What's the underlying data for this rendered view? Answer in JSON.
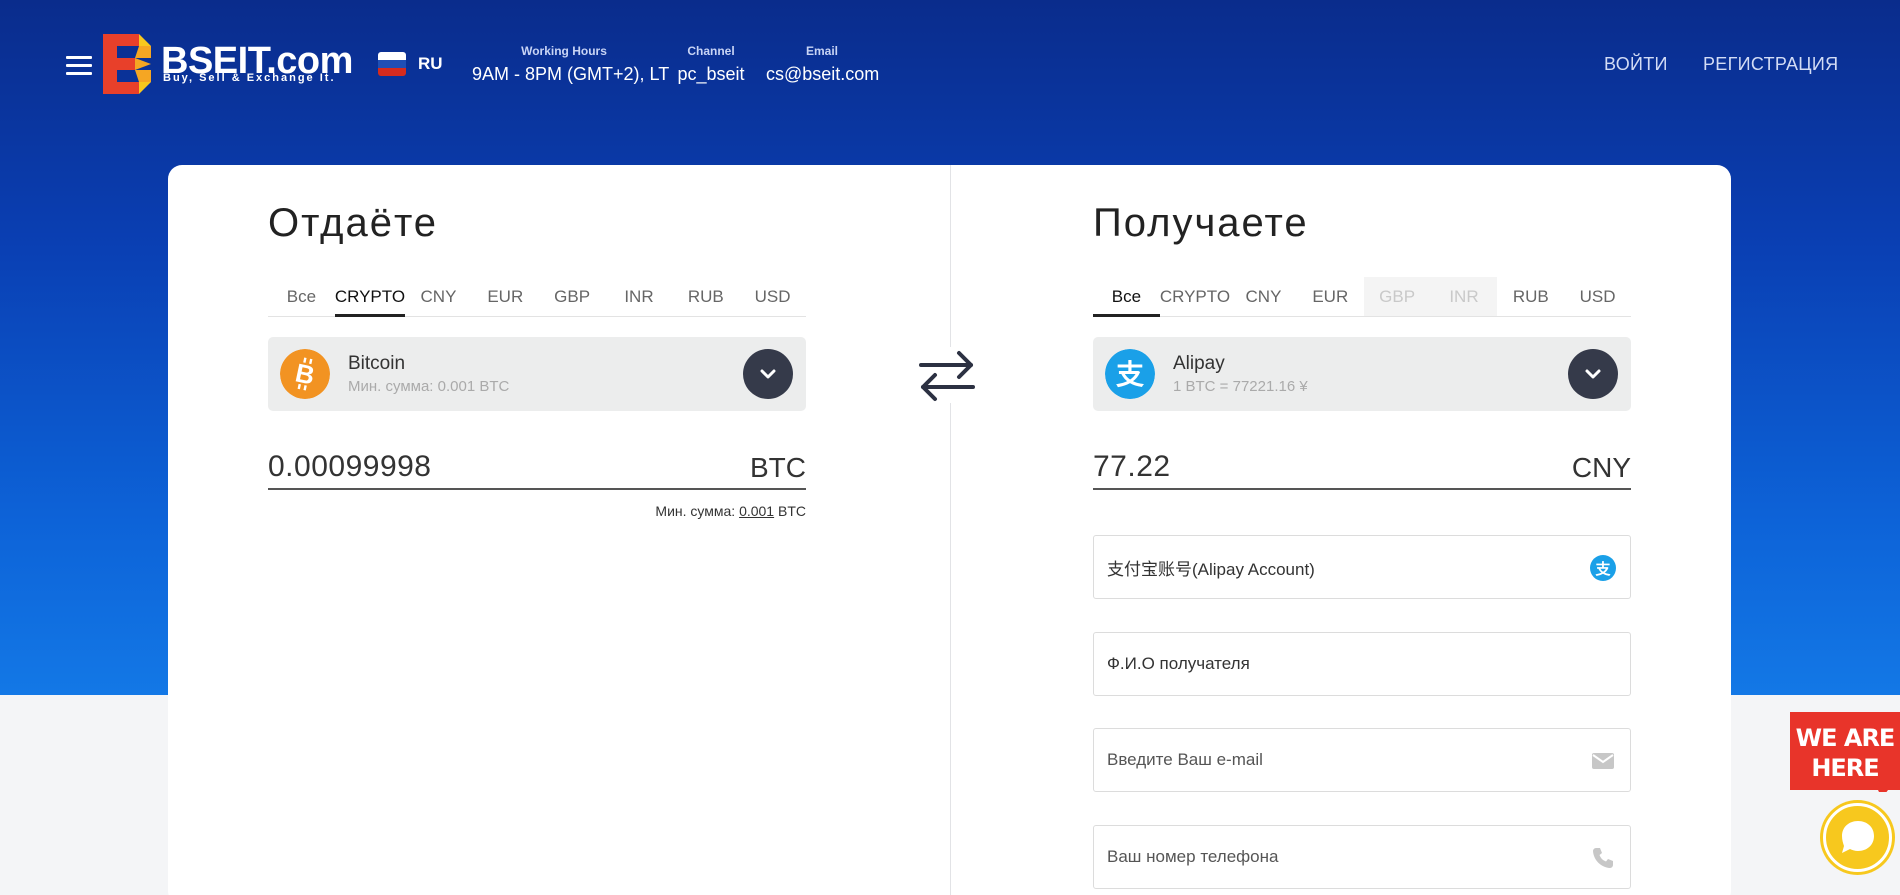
{
  "brand": {
    "name": "BSEIT.com",
    "tagline": "Buy, Sell & Exchange It.",
    "colors": {
      "orange": "#f5a623",
      "red": "#e8402a",
      "yellow": "#f7c81e",
      "hero_blue": "#0a3fb3"
    }
  },
  "header": {
    "menu_icon": "hamburger-icon",
    "language": {
      "code": "RU",
      "flag": "russia-flag-icon"
    },
    "info": [
      {
        "label": "Working Hours",
        "value": "9AM - 8PM (GMT+2), LT"
      },
      {
        "label": "Channel",
        "value": "pc_bseit"
      },
      {
        "label": "Email",
        "value": "cs@bseit.com"
      }
    ],
    "login": "ВОЙТИ",
    "register": "РЕГИСТРАЦИЯ"
  },
  "give": {
    "title": "Отдаёте",
    "tabs": [
      "Все",
      "CRYPTO",
      "CNY",
      "EUR",
      "GBP",
      "INR",
      "RUB",
      "USD"
    ],
    "active_tab": "CRYPTO",
    "currency": {
      "name": "Bitcoin",
      "sub": "Мин. сумма: 0.001 BTC",
      "icon": "bitcoin-icon"
    },
    "amount": "0.00099998",
    "amount_currency": "BTC",
    "min_note": {
      "prefix": "Мин. сумма:",
      "value": "0.001",
      "suffix": "BTC"
    }
  },
  "get": {
    "title": "Получаете",
    "tabs": [
      "Все",
      "CRYPTO",
      "CNY",
      "EUR",
      "GBP",
      "INR",
      "RUB",
      "USD"
    ],
    "active_tab": "Все",
    "disabled_tabs": [
      "GBP",
      "INR"
    ],
    "currency": {
      "name": "Alipay",
      "sub": "1 BTC = 77221.16 ¥",
      "icon": "alipay-icon"
    },
    "amount": "77.22",
    "amount_currency": "CNY",
    "fields": [
      {
        "value": "支付宝账号(Alipay Account)",
        "placeholder": "",
        "icon": "alipay-icon"
      },
      {
        "value": "Ф.И.О получателя",
        "placeholder": "",
        "icon": ""
      },
      {
        "value": "",
        "placeholder": "Введите Ваш e-mail",
        "icon": "mail-icon"
      },
      {
        "value": "",
        "placeholder": "Ваш номер телефона",
        "icon": "phone-icon"
      }
    ]
  },
  "swap_icon": "swap-arrows-icon",
  "chat": {
    "badge": "WE ARE HERE",
    "icon": "chat-bubble-icon"
  }
}
